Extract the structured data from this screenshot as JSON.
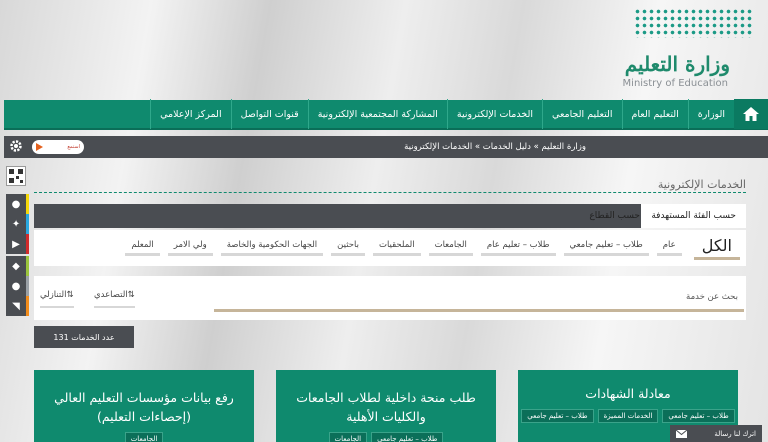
{
  "logo": {
    "arabic": "وزارة التعليم",
    "english": "Ministry of Education"
  },
  "nav": {
    "home_icon": "home-icon",
    "items": [
      "الوزارة",
      "التعليم العام",
      "التعليم الجامعي",
      "الخدمات الإلكترونية",
      "المشاركة المجتمعية الإلكترونية",
      "قنوات التواصل",
      "المركز الإعلامي"
    ]
  },
  "breadcrumb": "وزارة التعليم » دليل الخدمات » الخدمات الإلكترونية",
  "lang_toggle": "استمع",
  "section_title": "الخدمات الإلكترونية",
  "tabs": {
    "by_category": "حسب الفئة المستهدفة",
    "by_sector": "حسب القطاع"
  },
  "filters": {
    "all": "الكل",
    "items": [
      "عام",
      "طلاب – تعليم جامعي",
      "طلاب – تعليم عام",
      "الجامعات",
      "الملحقيات",
      "باحثين",
      "الجهات الحكومية والخاصة",
      "ولي الامر",
      "المعلم"
    ]
  },
  "search": {
    "placeholder": "بحث عن خدمة",
    "sort_asc": "التصاعدي",
    "sort_desc": "التنازلي"
  },
  "count_label": "عدد الخدمات 131",
  "cards": [
    {
      "title": "معادلة الشهادات",
      "tags": [
        "طلاب – تعليم جامعي",
        "الخدمات المميزة",
        "طلاب – تعليم جامعي"
      ]
    },
    {
      "title": "طلب منحة داخلية لطلاب الجامعات والكليات الأهلية",
      "tags": [
        "طلاب – تعليم جامعي",
        "الجامعات"
      ]
    },
    {
      "title": "رفع بيانات مؤسسات التعليم العالي (إحصاءات التعليم)",
      "tags": [
        "الجامعات"
      ]
    }
  ],
  "chat_label": "اترك لنا رسالة",
  "colors": {
    "primary": "#0f8a6e",
    "bar": "#4a4d52",
    "accent": "#c6b59a"
  }
}
